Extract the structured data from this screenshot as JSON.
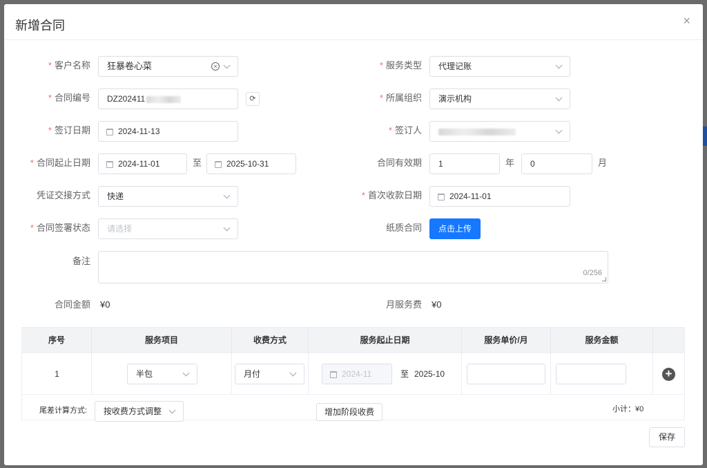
{
  "dialog": {
    "title": "新增合同",
    "close": "×"
  },
  "form": {
    "customer": {
      "label": "客户名称",
      "value": "狂暴卷心菜"
    },
    "service_type": {
      "label": "服务类型",
      "value": "代理记账"
    },
    "contract_no": {
      "label": "合同编号",
      "value": "DZ202411"
    },
    "organization": {
      "label": "所属组织",
      "value": "演示机构"
    },
    "sign_date": {
      "label": "签订日期",
      "value": "2024-11-13"
    },
    "signer": {
      "label": "签订人",
      "value": ""
    },
    "contract_period": {
      "label": "合同起止日期",
      "start": "2024-11-01",
      "to": "至",
      "end": "2025-10-31"
    },
    "validity": {
      "label": "合同有效期",
      "years": "1",
      "year_unit": "年",
      "months": "0",
      "month_unit": "月"
    },
    "voucher_method": {
      "label": "凭证交接方式",
      "value": "快递"
    },
    "first_payment_date": {
      "label": "首次收款日期",
      "value": "2024-11-01"
    },
    "sign_status": {
      "label": "合同签署状态",
      "placeholder": "请选择"
    },
    "paper_contract": {
      "label": "纸质合同",
      "button": "点击上传"
    },
    "remark": {
      "label": "备注",
      "counter": "0/256"
    },
    "contract_amount": {
      "label": "合同金额",
      "value": "¥0"
    },
    "monthly_fee": {
      "label": "月服务费",
      "value": "¥0"
    }
  },
  "table": {
    "headers": [
      "序号",
      "服务项目",
      "收费方式",
      "服务起止日期",
      "服务单价/月",
      "服务金额"
    ],
    "row": {
      "index": "1",
      "item": "半包",
      "billing": "月付",
      "start": "2024-11",
      "to": "至",
      "end": "2025-10"
    },
    "footer": {
      "rounding_label": "尾差计算方式:",
      "rounding_value": "按收费方式调整",
      "add_stage": "增加阶段收费",
      "subtotal": "小计：¥0"
    }
  },
  "actions": {
    "save": "保存"
  },
  "colors": {
    "primary": "#1677ff",
    "required": "#f56c6c"
  }
}
